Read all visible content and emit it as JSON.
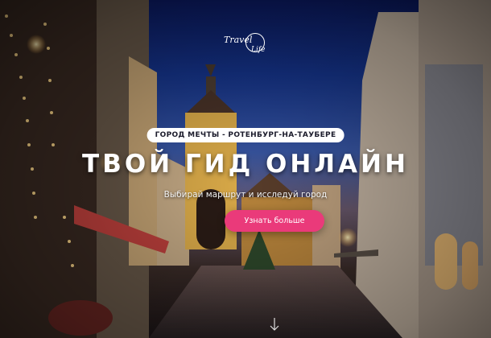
{
  "logo": {
    "word1": "Travel",
    "word2": "Life"
  },
  "hero": {
    "badge": "ГОРОД МЕЧТЫ - РОТЕНБУРГ-НА-ТАУБЕРЕ",
    "title": "ТВОЙ ГИД ОНЛАЙН",
    "subtitle": "Выбирай маршрут и исследуй город",
    "cta_label": "Узнать больше"
  },
  "colors": {
    "accent": "#ea3a7a",
    "sky": "#163690"
  },
  "icons": {
    "scroll": "arrow-down-icon"
  }
}
